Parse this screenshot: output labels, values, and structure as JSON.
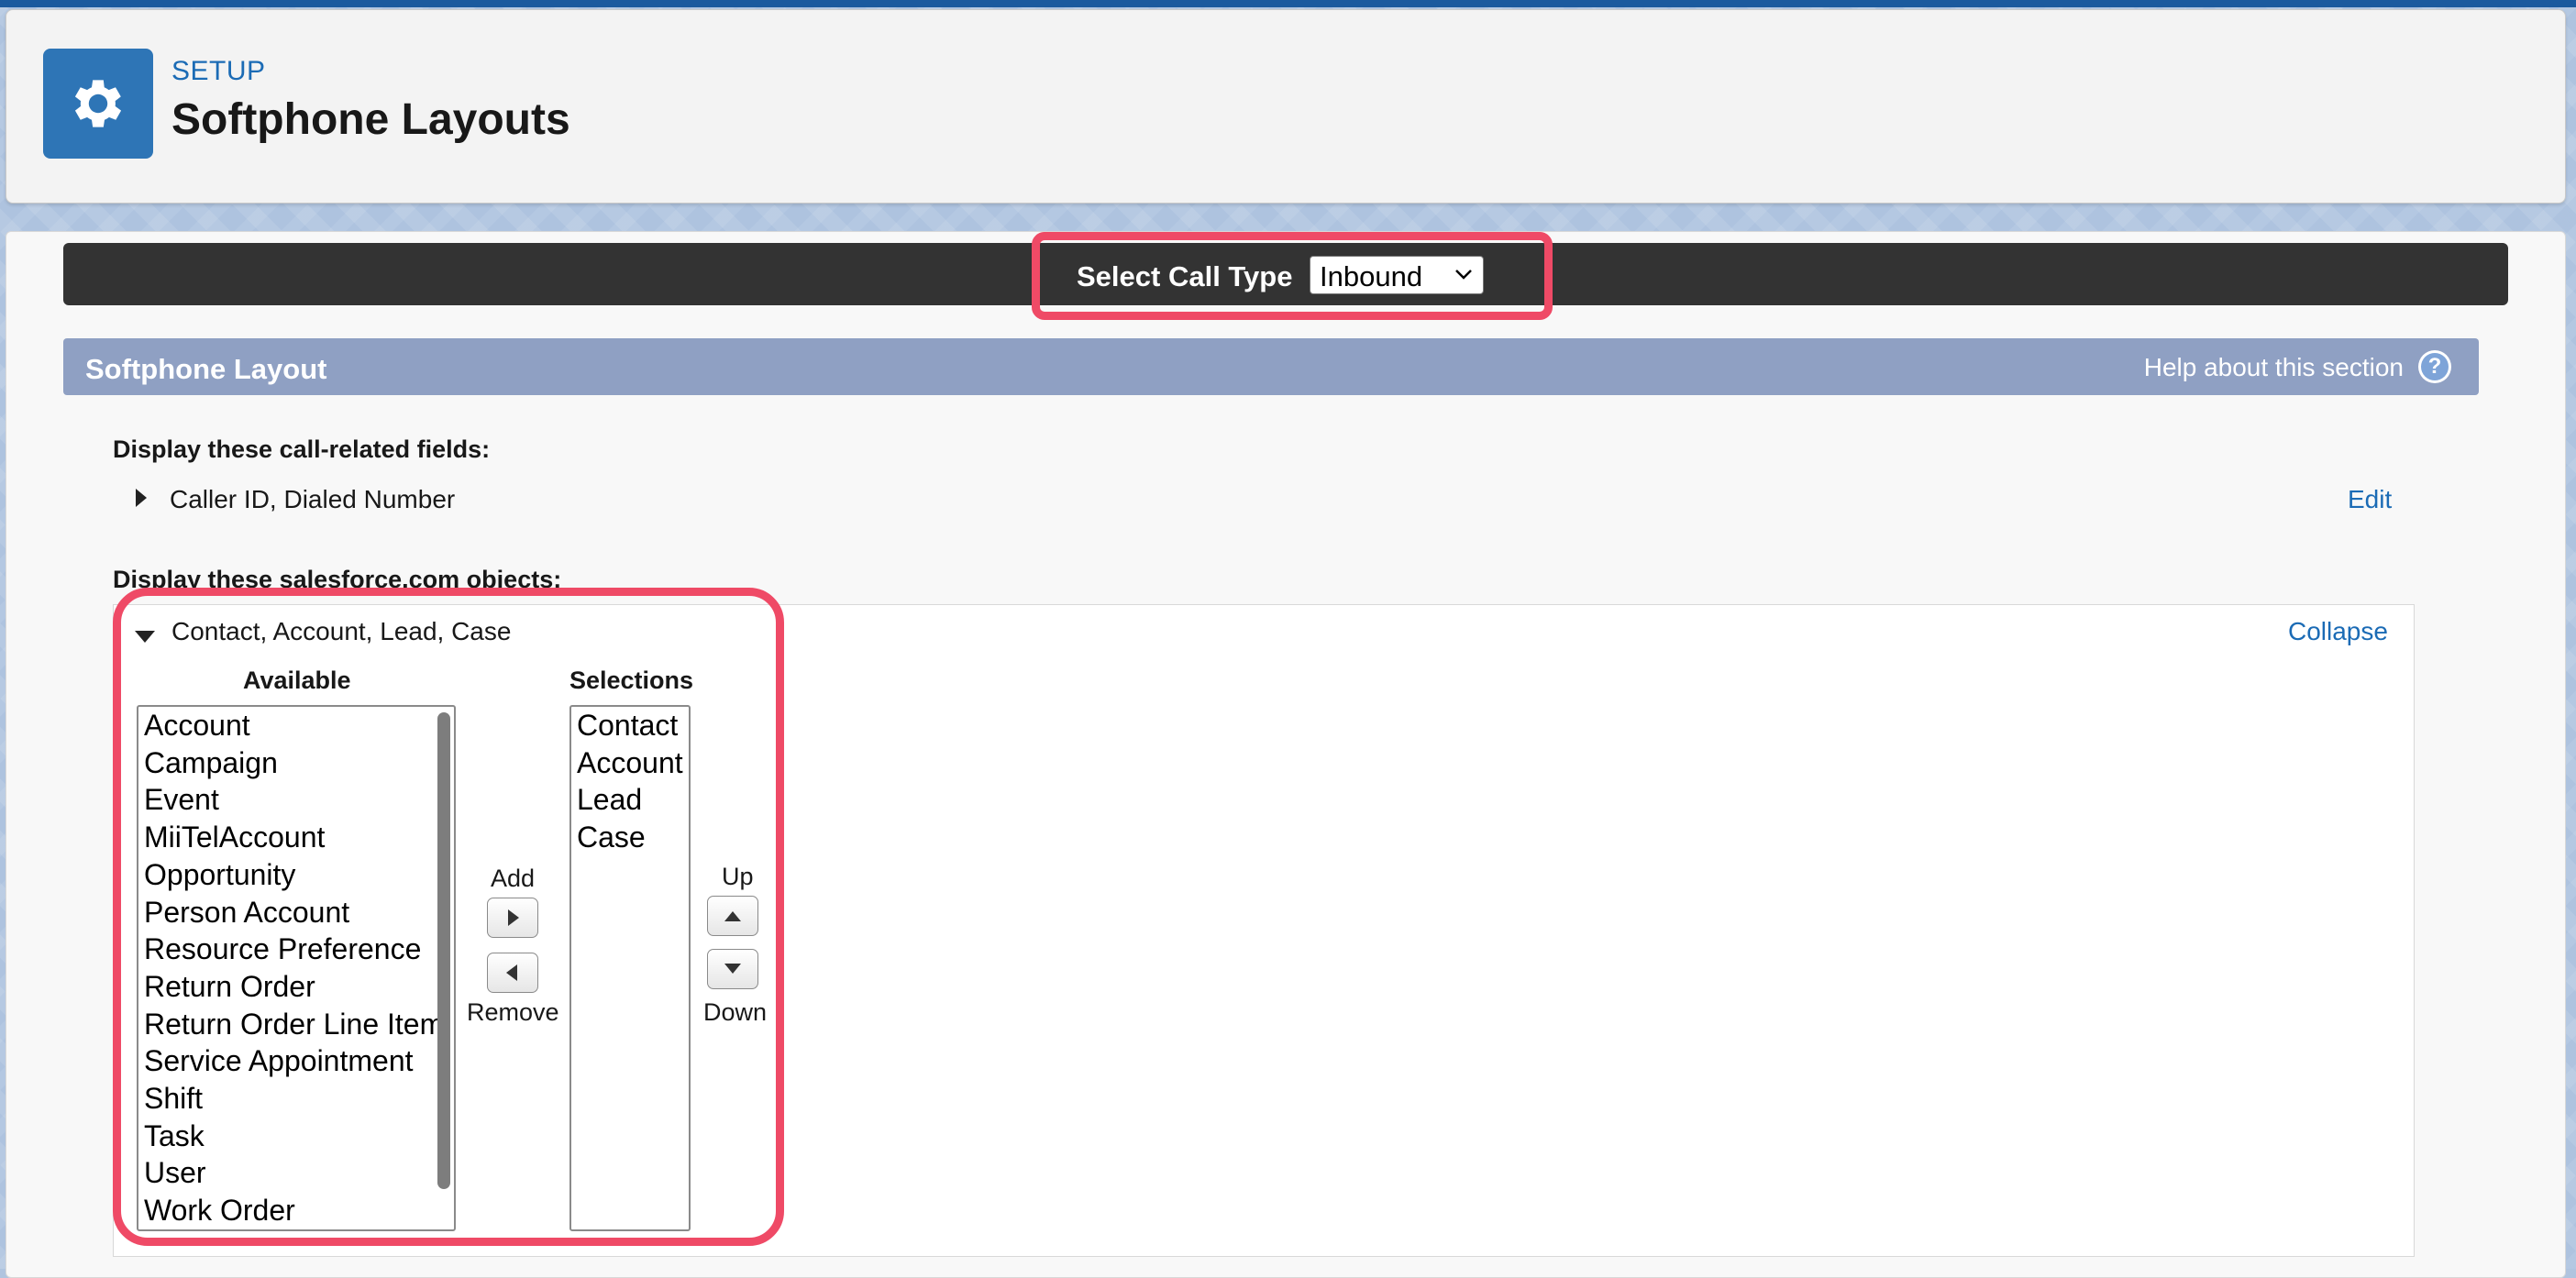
{
  "header": {
    "setup_label": "SETUP",
    "title": "Softphone Layouts",
    "icon": "gear-icon"
  },
  "call_type": {
    "label": "Select Call Type",
    "selected": "Inbound"
  },
  "section": {
    "title": "Softphone Layout",
    "help_text": "Help about this section",
    "help_icon": "?"
  },
  "call_fields": {
    "label": "Display these call-related fields:",
    "summary": "Caller ID, Dialed Number",
    "edit_link": "Edit"
  },
  "objects": {
    "label": "Display these salesforce.com objects:",
    "summary": "Contact, Account, Lead, Case",
    "collapse_link": "Collapse",
    "available_header": "Available",
    "selections_header": "Selections",
    "available": [
      "Account",
      "Campaign",
      "Event",
      "MiiTelAccount",
      "Opportunity",
      "Person Account",
      "Resource Preference",
      "Return Order",
      "Return Order Line Item",
      "Service Appointment",
      "Shift",
      "Task",
      "User",
      "Work Order"
    ],
    "selections": [
      "Contact",
      "Account",
      "Lead",
      "Case"
    ],
    "add_label": "Add",
    "remove_label": "Remove",
    "up_label": "Up",
    "down_label": "Down"
  },
  "colors": {
    "highlight": "#ef4a66",
    "section_bar": "#8fa0c3",
    "link": "#1b6bb5",
    "dark_bar": "#333333"
  }
}
